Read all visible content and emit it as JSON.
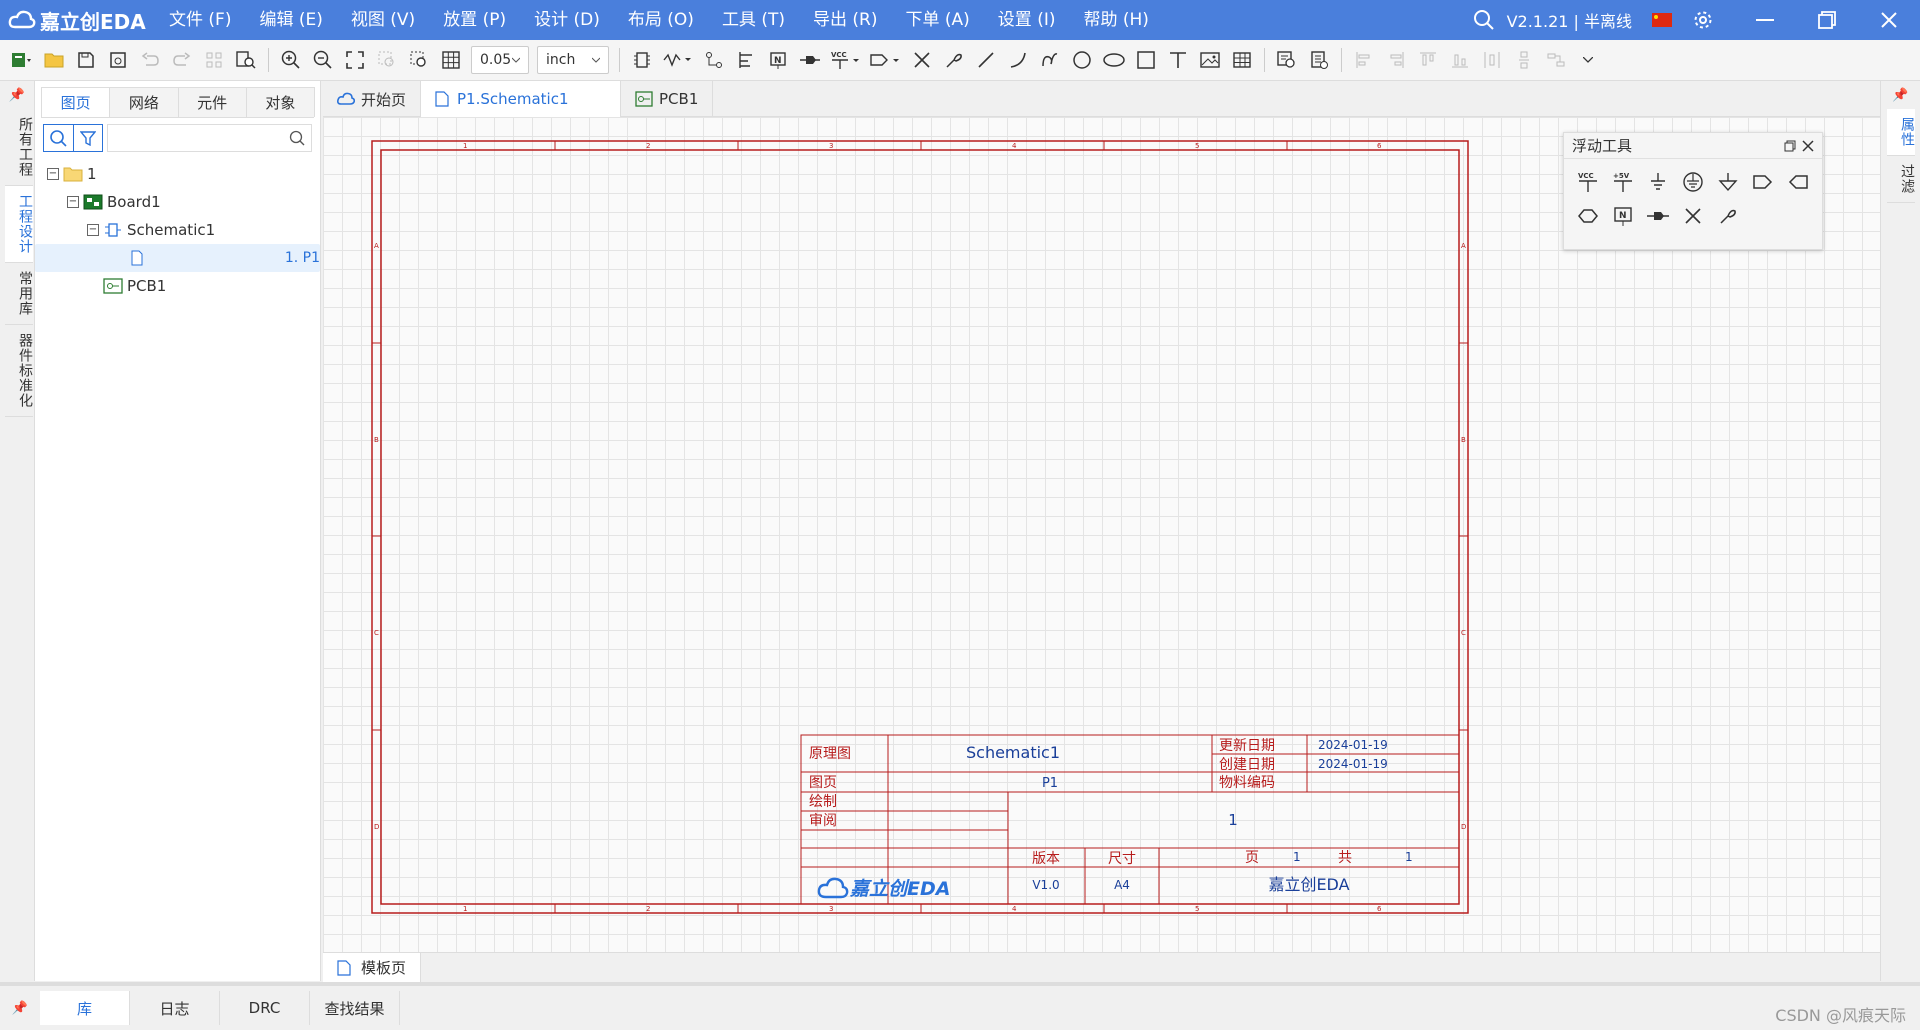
{
  "app": {
    "logo": "嘉立创EDA",
    "version": "V2.1.21 | 半离线"
  },
  "menu": [
    "文件 (F)",
    "编辑 (E)",
    "视图 (V)",
    "放置 (P)",
    "设计 (D)",
    "布局 (O)",
    "工具 (T)",
    "导出 (R)",
    "下单 (A)",
    "设置 (I)",
    "帮助 (H)"
  ],
  "toolbar": {
    "grid_value": "0.05",
    "unit": "inch"
  },
  "left_vtabs": [
    "所有工程",
    "工程设计",
    "常用库",
    "器件标准化"
  ],
  "panel_tabs": [
    "图页",
    "网络",
    "元件",
    "对象"
  ],
  "tree": [
    {
      "label": "1"
    },
    {
      "label": "Board1"
    },
    {
      "label": "Schematic1"
    },
    {
      "label": "1. P1"
    },
    {
      "label": "PCB1"
    }
  ],
  "doc_tabs": [
    "开始页",
    "P1.Schematic1",
    "PCB1"
  ],
  "right_vtabs": [
    "属性",
    "过滤"
  ],
  "float_panel": {
    "title": "浮动工具"
  },
  "title_block": {
    "type_label": "原理图",
    "schematic_name": "Schematic1",
    "update_label": "更新日期",
    "update_date": "2024-01-19",
    "create_label": "创建日期",
    "create_date": "2024-01-19",
    "page_label": "图页",
    "page_name": "P1",
    "part_label": "物料编码",
    "draw_label": "绘制",
    "review_label": "审阅",
    "center_num": "1",
    "version_label": "版本",
    "size_label": "尺寸",
    "page_cnt_label": "页",
    "page_cnt": "1",
    "total_label": "共",
    "total": "1",
    "version": "V1.0",
    "size": "A4",
    "company": "嘉立创EDA",
    "brand": "嘉立创EDA"
  },
  "frame_cols": [
    "1",
    "2",
    "3",
    "4",
    "5",
    "6"
  ],
  "frame_rows": [
    "A",
    "B",
    "C",
    "D"
  ],
  "bottom_page_tab": "模板页",
  "status_tabs": [
    "库",
    "日志",
    "DRC",
    "查找结果"
  ],
  "watermark": "CSDN @风痕天际"
}
